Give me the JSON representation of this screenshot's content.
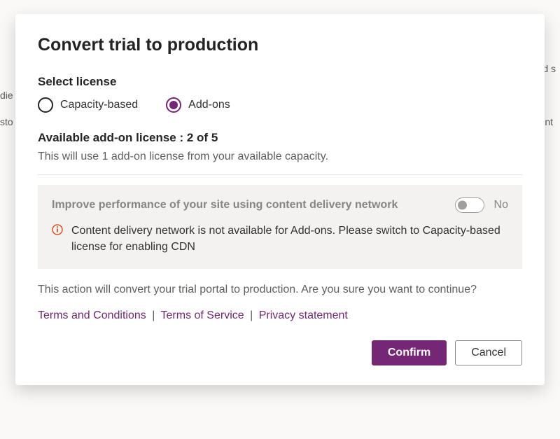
{
  "dialog": {
    "title": "Convert trial to production",
    "select_license_label": "Select license",
    "radio": {
      "capacity": "Capacity-based",
      "addons": "Add-ons",
      "selected": "addons"
    },
    "available_label": "Available add-on license : 2 of 5",
    "usage_desc": "This will use 1 add-on license from your available capacity.",
    "cdn": {
      "heading": "Improve performance of your site using content delivery network",
      "toggle_state": "No",
      "info": "Content delivery network is not available for Add-ons. Please switch to Capacity-based license for enabling CDN"
    },
    "confirm_text": "This action will convert your trial portal to production. Are you sure you want to continue?",
    "links": {
      "terms_conditions": "Terms and Conditions",
      "terms_service": "Terms of Service",
      "privacy": "Privacy statement"
    },
    "buttons": {
      "confirm": "Confirm",
      "cancel": "Cancel"
    }
  }
}
